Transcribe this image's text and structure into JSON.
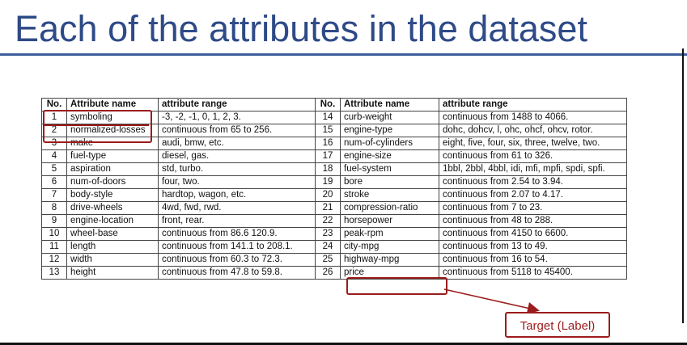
{
  "slide": {
    "title": "Each of the attributes in the dataset"
  },
  "table": {
    "headers": [
      "No.",
      "Attribute name",
      "attribute range",
      "No.",
      "Attribute name",
      "attribute range"
    ],
    "rows": [
      {
        "no1": "1",
        "name1": "symboling",
        "range1": "-3, -2, -1, 0, 1, 2, 3.",
        "no2": "14",
        "name2": "curb-weight",
        "range2": "continuous from 1488 to 4066."
      },
      {
        "no1": "2",
        "name1": "normalized-losses",
        "range1": "continuous from 65 to 256.",
        "no2": "15",
        "name2": "engine-type",
        "range2": "dohc, dohcv, l, ohc, ohcf, ohcv, rotor."
      },
      {
        "no1": "3",
        "name1": "make",
        "range1": "audi, bmw, etc.",
        "no2": "16",
        "name2": "num-of-cylinders",
        "range2": "eight, five, four, six, three, twelve, two."
      },
      {
        "no1": "4",
        "name1": "fuel-type",
        "range1": "diesel, gas.",
        "no2": "17",
        "name2": "engine-size",
        "range2": "continuous from 61 to 326."
      },
      {
        "no1": "5",
        "name1": "aspiration",
        "range1": "std, turbo.",
        "no2": "18",
        "name2": "fuel-system",
        "range2": "1bbl, 2bbl, 4bbl, idi, mfi, mpfi, spdi, spfi."
      },
      {
        "no1": "6",
        "name1": "num-of-doors",
        "range1": "four, two.",
        "no2": "19",
        "name2": "bore",
        "range2": "continuous from 2.54 to 3.94."
      },
      {
        "no1": "7",
        "name1": "body-style",
        "range1": "hardtop, wagon, etc.",
        "no2": "20",
        "name2": "stroke",
        "range2": "continuous from 2.07 to 4.17."
      },
      {
        "no1": "8",
        "name1": "drive-wheels",
        "range1": "4wd, fwd, rwd.",
        "no2": "21",
        "name2": "compression-ratio",
        "range2": "continuous from 7 to 23."
      },
      {
        "no1": "9",
        "name1": "engine-location",
        "range1": "front, rear.",
        "no2": "22",
        "name2": "horsepower",
        "range2": "continuous from 48 to 288."
      },
      {
        "no1": "10",
        "name1": "wheel-base",
        "range1": "continuous from 86.6 120.9.",
        "no2": "23",
        "name2": "peak-rpm",
        "range2": "continuous from 4150 to 6600."
      },
      {
        "no1": "11",
        "name1": "length",
        "range1": "continuous from 141.1 to 208.1.",
        "no2": "24",
        "name2": "city-mpg",
        "range2": "continuous from 13 to 49."
      },
      {
        "no1": "12",
        "name1": "width",
        "range1": "continuous from 60.3 to 72.3.",
        "no2": "25",
        "name2": "highway-mpg",
        "range2": "continuous from 16 to 54."
      },
      {
        "no1": "13",
        "name1": "height",
        "range1": "continuous from 47.8 to 59.8.",
        "no2": "26",
        "name2": "price",
        "range2": "continuous from 5118 to 45400."
      }
    ]
  },
  "annotation": {
    "target_label": "Target (Label)",
    "highlight_color": "#9b1c1c"
  },
  "colors": {
    "title": "#2e4a87",
    "rule": "#3d5e9c"
  }
}
